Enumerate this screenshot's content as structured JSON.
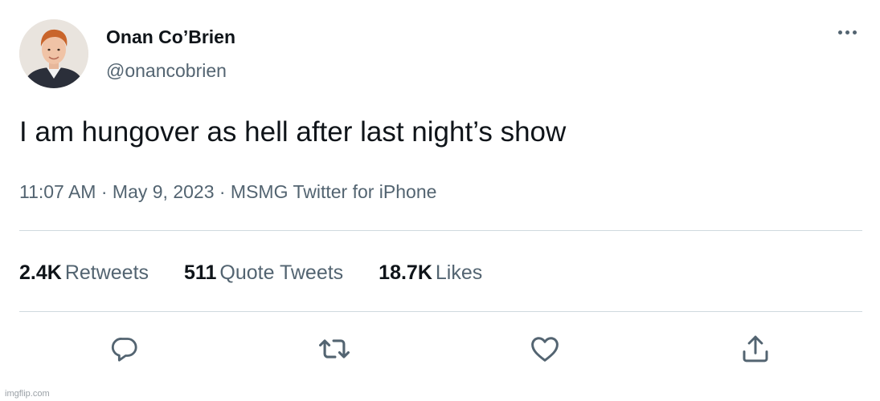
{
  "author": {
    "display_name": "Onan Co’Brien",
    "handle": "@onancobrien",
    "avatar_icon": "user-avatar-photo"
  },
  "tweet": {
    "text": "I am hungover as hell after last night’s show",
    "meta": "11:07 AM · May 9, 2023 · MSMG Twitter for iPhone"
  },
  "stats": {
    "retweets_count": "2.4K",
    "retweets_label": "Retweets",
    "quotes_count": "511",
    "quotes_label": "Quote Tweets",
    "likes_count": "18.7K",
    "likes_label": "Likes"
  },
  "actions": {
    "icons": [
      "reply-icon",
      "retweet-icon",
      "like-icon",
      "share-icon"
    ]
  },
  "watermark": "imgflip.com",
  "colors": {
    "text_primary": "#0f1419",
    "text_secondary": "#536471",
    "divider": "#cfd9de"
  }
}
